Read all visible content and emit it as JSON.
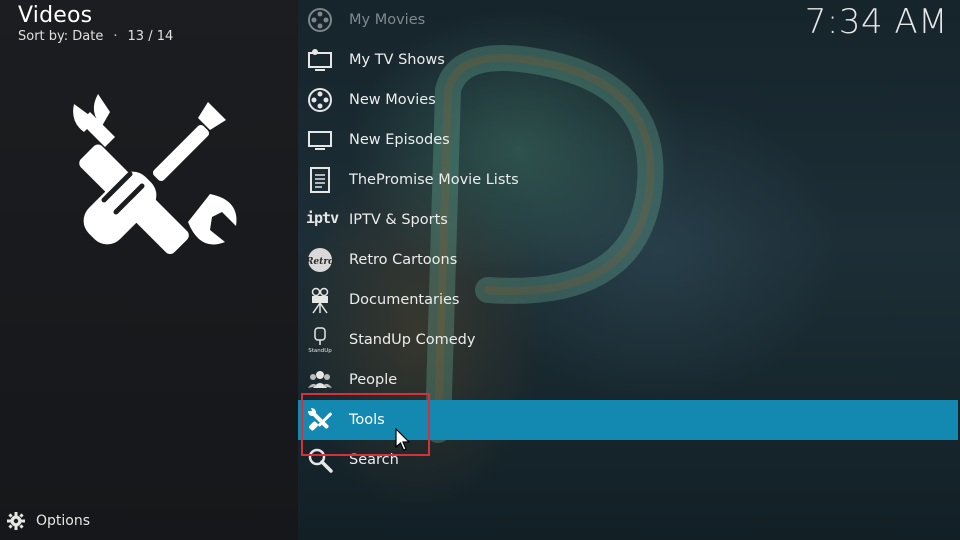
{
  "header": {
    "title": "Videos",
    "sort_label": "Sort by: Date",
    "separator": "·",
    "position": "13 / 14"
  },
  "clock": "7:34 AM",
  "footer": {
    "options_label": "Options",
    "options_icon": "options-gear-icon"
  },
  "preview_icon": "tools-icon",
  "colors": {
    "accent": "#1389b1",
    "highlight_border": "#d6303a"
  },
  "menu": {
    "items": [
      {
        "label": "My Movies",
        "icon": "film-reel-icon",
        "state": "dim"
      },
      {
        "label": "My TV Shows",
        "icon": "tv-icon",
        "state": "normal"
      },
      {
        "label": "New Movies",
        "icon": "film-reel-icon",
        "state": "normal"
      },
      {
        "label": "New Episodes",
        "icon": "tv-icon",
        "state": "normal"
      },
      {
        "label": "ThePromise Movie Lists",
        "icon": "document-list-icon",
        "state": "normal"
      },
      {
        "label": "IPTV & Sports",
        "icon": "iptv-icon",
        "state": "normal"
      },
      {
        "label": "Retro Cartoons",
        "icon": "retro-logo-icon",
        "state": "normal"
      },
      {
        "label": "Documentaries",
        "icon": "camera-tripod-icon",
        "state": "normal"
      },
      {
        "label": "StandUp Comedy",
        "icon": "standup-mic-icon",
        "state": "normal"
      },
      {
        "label": "People",
        "icon": "people-icon",
        "state": "normal"
      },
      {
        "label": "Tools",
        "icon": "tools-icon",
        "state": "selected"
      },
      {
        "label": "Search",
        "icon": "search-icon",
        "state": "normal"
      }
    ],
    "iptv_icon_text": "iptv",
    "retro_icon_text": "Retro",
    "standup_icon_text": "StandUp"
  }
}
